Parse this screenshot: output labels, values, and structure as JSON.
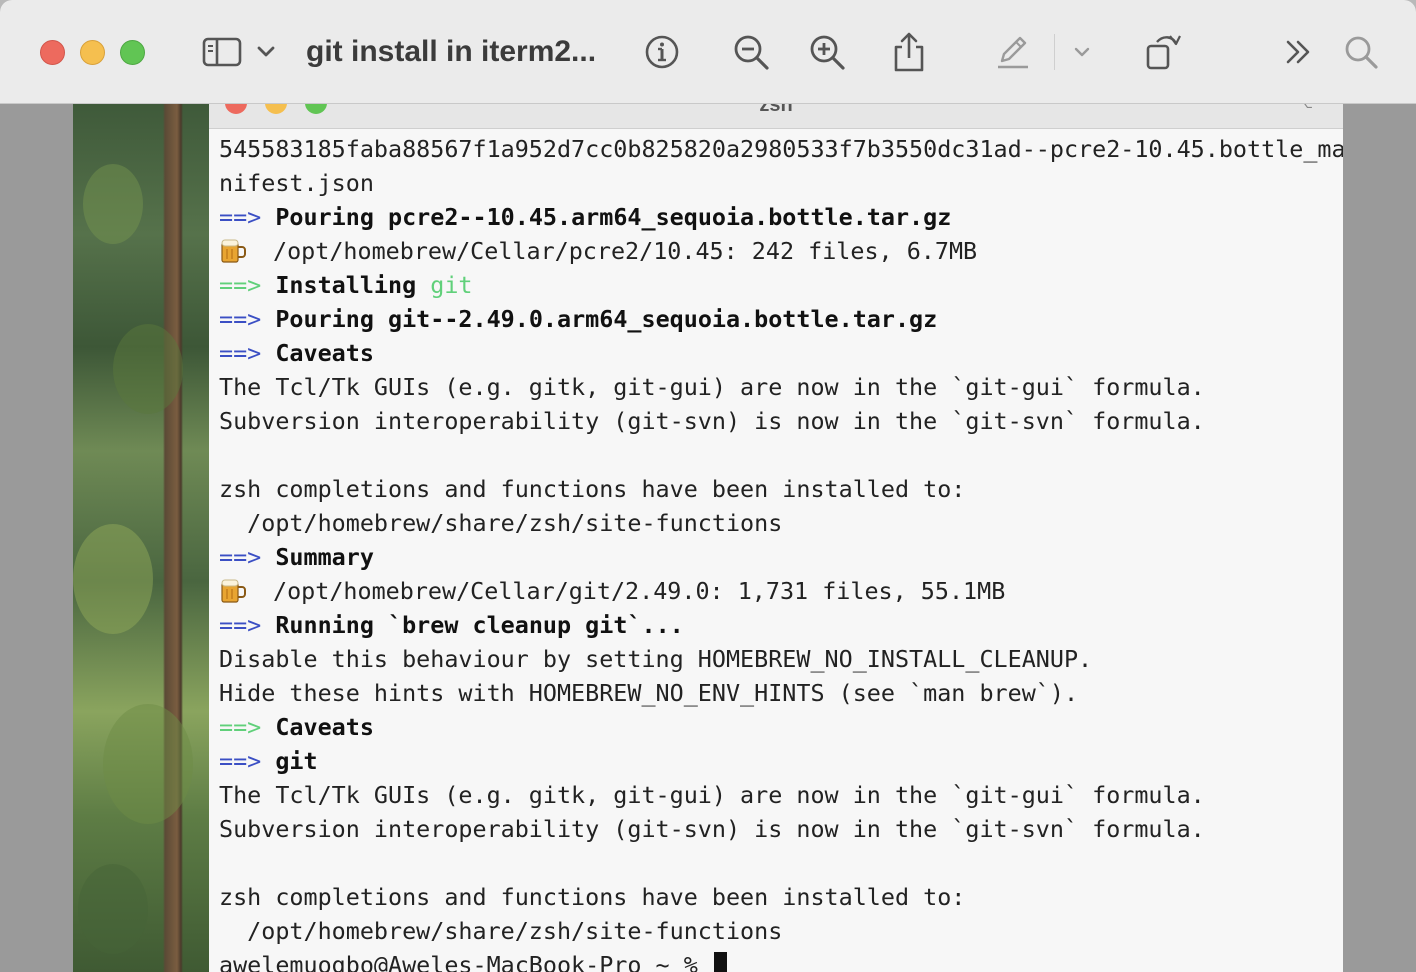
{
  "window": {
    "title": "git install in iterm2..."
  },
  "toolbar": {
    "icons": [
      "sidebar-icon",
      "chevron-down-icon",
      "info-icon",
      "zoom-out-icon",
      "zoom-in-icon",
      "share-icon",
      "markup-pen-icon",
      "chevron-down-icon",
      "rotate-icon",
      "more-icon",
      "search-icon"
    ]
  },
  "terminal": {
    "title": "zsh",
    "lines": [
      {
        "text": "545583185faba88567f1a952d7cc0b825820a2980533f7b3550dc31ad--pcre2-10.45.bottle_ma"
      },
      {
        "text": "nifest.json"
      },
      {
        "arrow": "==>",
        "bold": "Pouring pcre2--10.45.arm64_sequoia.bottle.tar.gz"
      },
      {
        "beer": true,
        "text": "/opt/homebrew/Cellar/pcre2/10.45: 242 files, 6.7MB"
      },
      {
        "arrow_green": "==>",
        "bold": "Installing",
        "green": "git"
      },
      {
        "arrow": "==>",
        "bold": "Pouring git--2.49.0.arm64_sequoia.bottle.tar.gz"
      },
      {
        "arrow": "==>",
        "bold": "Caveats"
      },
      {
        "text": "The Tcl/Tk GUIs (e.g. gitk, git-gui) are now in the `git-gui` formula."
      },
      {
        "text": "Subversion interoperability (git-svn) is now in the `git-svn` formula."
      },
      {
        "text": ""
      },
      {
        "text": "zsh completions and functions have been installed to:"
      },
      {
        "text": "  /opt/homebrew/share/zsh/site-functions"
      },
      {
        "arrow": "==>",
        "bold": "Summary"
      },
      {
        "beer": true,
        "text": "/opt/homebrew/Cellar/git/2.49.0: 1,731 files, 55.1MB"
      },
      {
        "arrow": "==>",
        "bold": "Running `brew cleanup git`..."
      },
      {
        "text": "Disable this behaviour by setting HOMEBREW_NO_INSTALL_CLEANUP."
      },
      {
        "text": "Hide these hints with HOMEBREW_NO_ENV_HINTS (see `man brew`)."
      },
      {
        "arrow_green": "==>",
        "bold": "Caveats"
      },
      {
        "arrow": "==>",
        "bold": "git"
      },
      {
        "text": "The Tcl/Tk GUIs (e.g. gitk, git-gui) are now in the `git-gui` formula."
      },
      {
        "text": "Subversion interoperability (git-svn) is now in the `git-svn` formula."
      },
      {
        "text": ""
      },
      {
        "text": "zsh completions and functions have been installed to:"
      },
      {
        "text": "  /opt/homebrew/share/zsh/site-functions"
      },
      {
        "prompt": "awelemuogbo@Aweles-MacBook-Pro ~ % ",
        "cursor": true
      }
    ]
  },
  "colors": {
    "arrow_blue": "#3b4fc4",
    "arrow_green": "#60d07a",
    "green_text": "#60d07a"
  }
}
